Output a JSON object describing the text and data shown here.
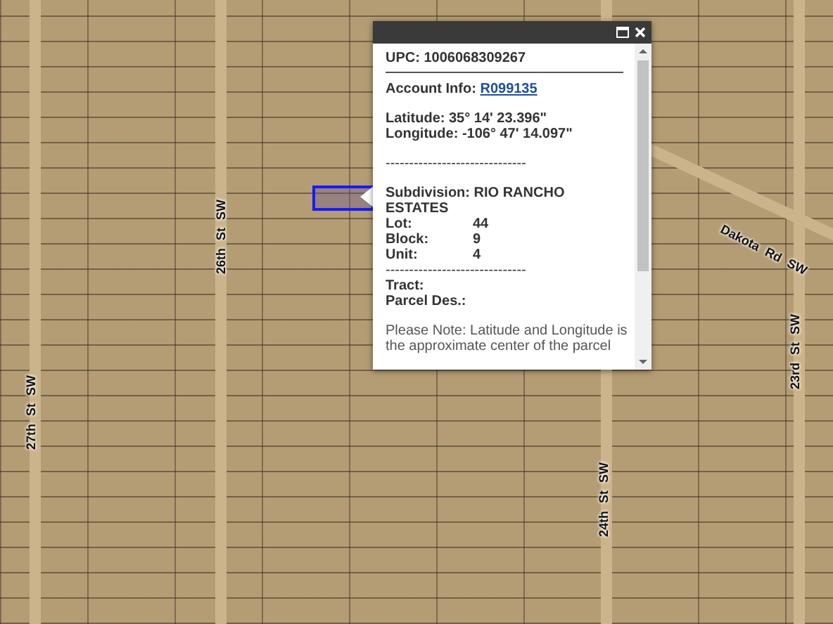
{
  "map": {
    "street_labels": [
      {
        "text": "26th St SW",
        "kind": "vertical"
      },
      {
        "text": "27th St SW",
        "kind": "vertical"
      },
      {
        "text": "24th St SW",
        "kind": "vertical"
      },
      {
        "text": "23rd St SW",
        "kind": "vertical"
      },
      {
        "text": "Dakota Rd SW",
        "kind": "diagonal"
      }
    ]
  },
  "popup": {
    "upc": {
      "label": "UPC:",
      "value": "1006068309267"
    },
    "account": {
      "label": "Account Info:",
      "value": "R099135"
    },
    "latitude": {
      "label": "Latitude:",
      "value": "35° 14' 23.396\""
    },
    "longitude": {
      "label": "Longitude:",
      "value": "-106° 47' 14.097\""
    },
    "separator_1": "------------------------------",
    "subdivision": {
      "label": "Subdivision:",
      "value": "RIO RANCHO ESTATES"
    },
    "fields": [
      {
        "label": "Lot:",
        "value": "44"
      },
      {
        "label": "Block:",
        "value": "9"
      },
      {
        "label": "Unit:",
        "value": "4"
      }
    ],
    "separator_2": "------------------------------",
    "extra_fields": [
      {
        "label": "Tract:"
      },
      {
        "label": "Parcel Des.:"
      }
    ],
    "note": "Please Note: Latitude and Longitude is the approximate center of the parcel"
  }
}
